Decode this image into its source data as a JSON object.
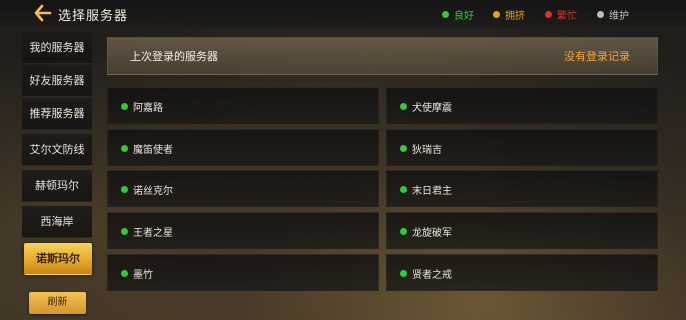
{
  "header": {
    "title": "选择服务器",
    "legend": {
      "good": "良好",
      "busy": "拥挤",
      "full": "繁忙",
      "maintenance": "维护"
    }
  },
  "colors": {
    "good": "#37c640",
    "busy": "#e0a524",
    "full": "#e0302a",
    "maintenance": "#bdbdbd",
    "accent_gold": "#e6a92c"
  },
  "sidebar": {
    "items": [
      {
        "label": "我的服务器"
      },
      {
        "label": "好友服务器"
      },
      {
        "label": "推荐服务器"
      },
      {
        "label": "艾尔文防线"
      },
      {
        "label": "赫顿玛尔"
      },
      {
        "label": "西海岸"
      },
      {
        "label": "诺斯玛尔"
      }
    ],
    "selected": "诺斯玛尔",
    "refresh_label": "刷新"
  },
  "main": {
    "last_login_label": "上次登录的服务器",
    "no_record_label": "没有登录记录",
    "servers": [
      {
        "name": "阿嘉路",
        "status": "good"
      },
      {
        "name": "犬使摩震",
        "status": "good"
      },
      {
        "name": "魔笛使者",
        "status": "good"
      },
      {
        "name": "狄瑞吉",
        "status": "good"
      },
      {
        "name": "诺丝克尔",
        "status": "good"
      },
      {
        "name": "末日君主",
        "status": "good"
      },
      {
        "name": "王者之星",
        "status": "good"
      },
      {
        "name": "龙旋破军",
        "status": "good"
      },
      {
        "name": "墨竹",
        "status": "good"
      },
      {
        "name": "贤者之戒",
        "status": "good"
      }
    ]
  }
}
